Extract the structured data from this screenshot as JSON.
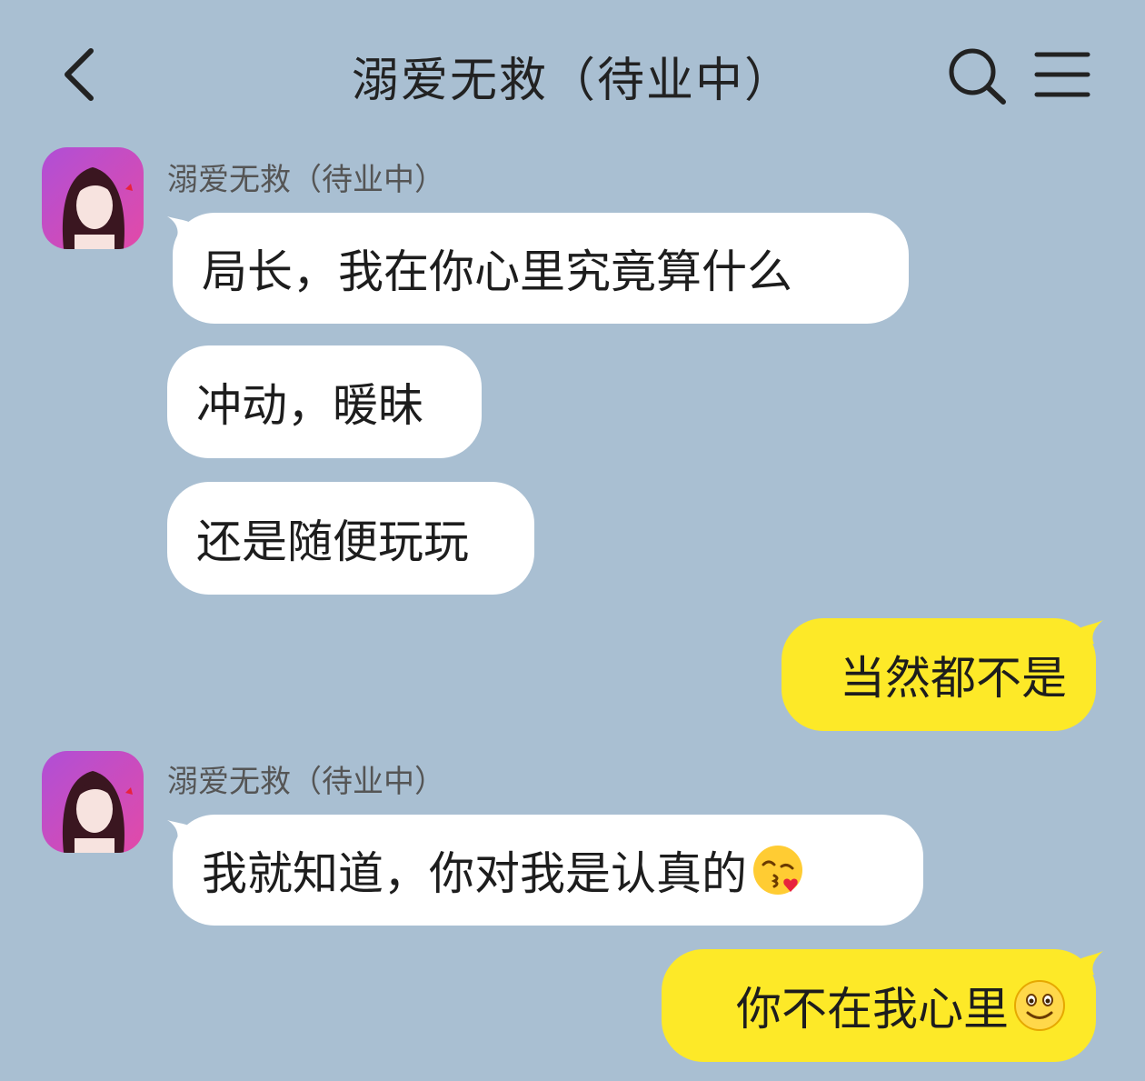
{
  "header": {
    "title": "溺爱无救（待业中）",
    "back_icon": "chevron-left-icon",
    "search_icon": "search-icon",
    "menu_icon": "menu-icon"
  },
  "colors": {
    "background": "#a9bfd2",
    "incoming_bubble": "#ffffff",
    "outgoing_bubble": "#fde928"
  },
  "messages": [
    {
      "direction": "incoming",
      "sender": "溺爱无救（待业中）",
      "text": "局长，我在你心里究竟算什么"
    },
    {
      "direction": "incoming",
      "text": "冲动，暖昧"
    },
    {
      "direction": "incoming",
      "text": "还是随便玩玩"
    },
    {
      "direction": "outgoing",
      "text": "当然都不是"
    },
    {
      "direction": "incoming",
      "sender": "溺爱无救（待业中）",
      "text": "我就知道，你对我是认真的",
      "emoji": "kissing-heart-emoji"
    },
    {
      "direction": "outgoing",
      "text": "你不在我心里",
      "emoji": "smiley-emoji"
    }
  ]
}
